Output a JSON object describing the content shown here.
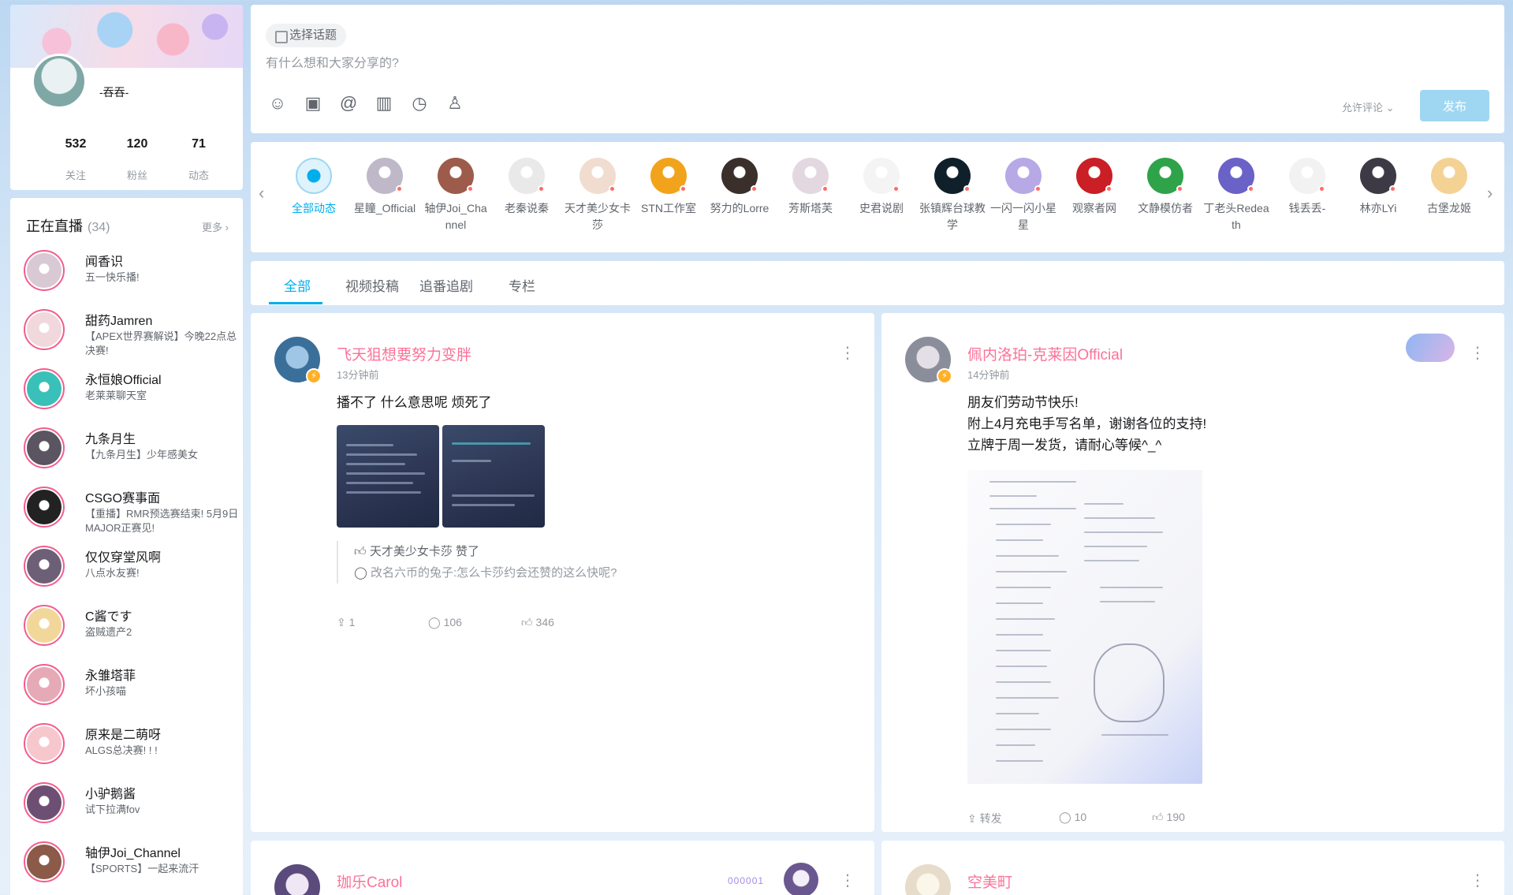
{
  "profile": {
    "name": "-吞吞-",
    "stats": [
      {
        "value": "532",
        "label": "关注"
      },
      {
        "value": "120",
        "label": "粉丝"
      },
      {
        "value": "71",
        "label": "动态"
      }
    ]
  },
  "live": {
    "title": "正在直播",
    "count": "(34)",
    "more": "更多",
    "items": [
      {
        "name": "闻香识",
        "title": "五一快乐播!",
        "color": "#d9c9d4"
      },
      {
        "name": "甜药Jamren",
        "title": "【APEX世界赛解说】今晚22点总决赛!",
        "color": "#f0d8dd"
      },
      {
        "name": "永恒娘Official",
        "title": "老莱莱聊天室",
        "color": "#39c0b8"
      },
      {
        "name": "九条月生",
        "title": "【九条月生】少年感美女",
        "color": "#5a5560"
      },
      {
        "name": "CSGO赛事面",
        "title": "【重播】RMR预选赛结束! 5月9日MAJOR正赛见!",
        "color": "#222222"
      },
      {
        "name": "仅仅穿堂风啊",
        "title": "八点水友赛!",
        "color": "#6d5f76"
      },
      {
        "name": "C酱です",
        "title": "盗贼遗产2",
        "color": "#f2d79a"
      },
      {
        "name": "永雏塔菲",
        "title": "坏小孩喵",
        "color": "#e6a9b6"
      },
      {
        "name": "原来是二萌呀",
        "title": "ALGS总决赛! ! !",
        "color": "#f6c7cc"
      },
      {
        "name": "小驴鹅酱",
        "title": "试下拉满fov",
        "color": "#6e4f74"
      },
      {
        "name": "轴伊Joi_Channel",
        "title": "【SPORTS】一起来流汗",
        "color": "#8b5a48"
      }
    ]
  },
  "composer": {
    "topic": "选择话题",
    "placeholder": "有什么想和大家分享的?",
    "allow_comment": "允许评论",
    "publish": "发布",
    "tools": [
      "emoji-icon",
      "image-icon",
      "at-icon",
      "vote-icon",
      "schedule-icon",
      "reserve-icon"
    ]
  },
  "following": [
    {
      "name": "全部动态",
      "color": "#dff3fc",
      "active": true,
      "live": false
    },
    {
      "name": "星瞳_Official",
      "color": "#bfb8c9",
      "live": true
    },
    {
      "name": "轴伊Joi_Channel",
      "color": "#9c5b4b",
      "live": true
    },
    {
      "name": "老秦说秦",
      "color": "#e9e9e9",
      "live": true
    },
    {
      "name": "天才美少女卡莎",
      "color": "#f1dcd0",
      "live": true
    },
    {
      "name": "STN工作室",
      "color": "#f2a31c",
      "live": true
    },
    {
      "name": "努力的Lorre",
      "color": "#3a2f2b",
      "live": true
    },
    {
      "name": "芳斯塔芙",
      "color": "#e3d7e0",
      "live": true
    },
    {
      "name": "史君说剧",
      "color": "#f4f4f4",
      "live": true
    },
    {
      "name": "张镇辉台球教学",
      "color": "#10202a",
      "live": true
    },
    {
      "name": "一闪一闪小星星",
      "color": "#b7a8e6",
      "live": true
    },
    {
      "name": "观察者网",
      "color": "#c91f25",
      "live": true
    },
    {
      "name": "文静模仿者",
      "color": "#2ea34a",
      "live": true
    },
    {
      "name": "丁老头Redeath",
      "color": "#6a62c7",
      "live": true
    },
    {
      "name": "钱丢丢-",
      "color": "#f2f2f2",
      "live": true
    },
    {
      "name": "林亦LYi",
      "color": "#3d3a45",
      "live": true
    },
    {
      "name": "古堡龙姬",
      "color": "#f3d294",
      "live": false
    }
  ],
  "tabs": [
    "全部",
    "视频投稿",
    "追番追剧",
    "专栏"
  ],
  "posts": [
    {
      "author": "飞天狙想要努力变胖",
      "time": "13分钟前",
      "text": "播不了 什么意思呢 烦死了",
      "like_line": "天才美少女卡莎 赞了",
      "comment_user": "改名六币的兔子:",
      "comment_text": "怎么卡莎约会还赞的这么快呢?",
      "share": "1",
      "comments": "106",
      "likes": "346",
      "avatar_color": "#3a6f9a"
    },
    {
      "author": "佩内洛珀-克莱因Official",
      "time": "14分钟前",
      "text_lines": [
        "朋友们劳动节快乐!",
        "附上4月充电手写名单，谢谢各位的支持!",
        "立牌于周一发货，请耐心等候^_^"
      ],
      "share": "转发",
      "comments": "10",
      "likes": "190",
      "avatar_color": "#8a8e9a"
    },
    {
      "author": "珈乐Carol",
      "badge": "000001",
      "avatar_color": "#5b4a7c"
    },
    {
      "author": "空美町",
      "avatar_color": "#e7dcc9"
    }
  ]
}
